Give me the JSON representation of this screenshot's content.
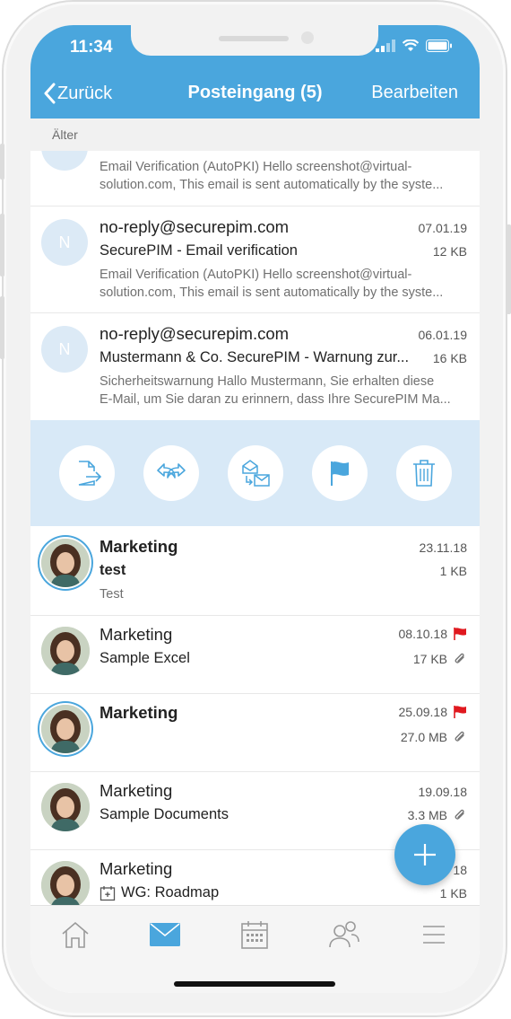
{
  "status_bar": {
    "time": "11:34"
  },
  "nav": {
    "back_label": "Zurück",
    "title": "Posteingang (5)",
    "edit_label": "Bearbeiten"
  },
  "section_header": "Älter",
  "emails_top": [
    {
      "preview_line1": "Email Verification (AutoPKI) Hello screenshot@virtual-",
      "preview_line2": "solution.com, This email is sent automatically by the syste..."
    },
    {
      "initial": "N",
      "sender": "no-reply@securepim.com",
      "date": "07.01.19",
      "subject": "SecurePIM - Email verification",
      "size": "12 KB",
      "preview_line1": "Email Verification (AutoPKI) Hello screenshot@virtual-",
      "preview_line2": "solution.com, This email is sent automatically by the syste..."
    },
    {
      "initial": "N",
      "sender": "no-reply@securepim.com",
      "date": "06.01.19",
      "subject": "Mustermann & Co. SecurePIM - Warnung zur...",
      "size": "16 KB",
      "preview_line1": "Sicherheitswarnung Hallo Mustermann, Sie erhalten diese",
      "preview_line2": "E-Mail, um Sie daran zu erinnern, dass Ihre SecurePIM Ma..."
    }
  ],
  "action_bar": {
    "icons": [
      "move-to-folder-icon",
      "reply-forward-icon",
      "mark-unread-icon",
      "flag-icon",
      "trash-icon"
    ]
  },
  "emails_bottom": [
    {
      "sender": "Marketing",
      "date": "23.11.18",
      "subject": "test",
      "size": "1 KB",
      "preview": "Test",
      "flag": false,
      "attachment": false
    },
    {
      "sender": "Marketing",
      "date": "08.10.18",
      "subject": "Sample Excel",
      "size": "17 KB",
      "flag": true,
      "attachment": true
    },
    {
      "sender": "Marketing",
      "date": "25.09.18",
      "subject": "",
      "size": "27.0 MB",
      "flag": true,
      "attachment": true
    },
    {
      "sender": "Marketing",
      "date": "19.09.18",
      "subject": "Sample Documents",
      "size": "3.3 MB",
      "flag": false,
      "attachment": true
    },
    {
      "sender": "Marketing",
      "date": "18",
      "subject": "WG: Roadmap",
      "size": "1 KB",
      "flag": false,
      "attachment": false
    }
  ],
  "tabs": [
    "home-icon",
    "mail-icon",
    "calendar-icon",
    "contacts-icon",
    "menu-icon"
  ],
  "colors": {
    "accent": "#4aa6dd",
    "flag": "#e0191f",
    "action_bar_bg": "#d8e9f7"
  }
}
